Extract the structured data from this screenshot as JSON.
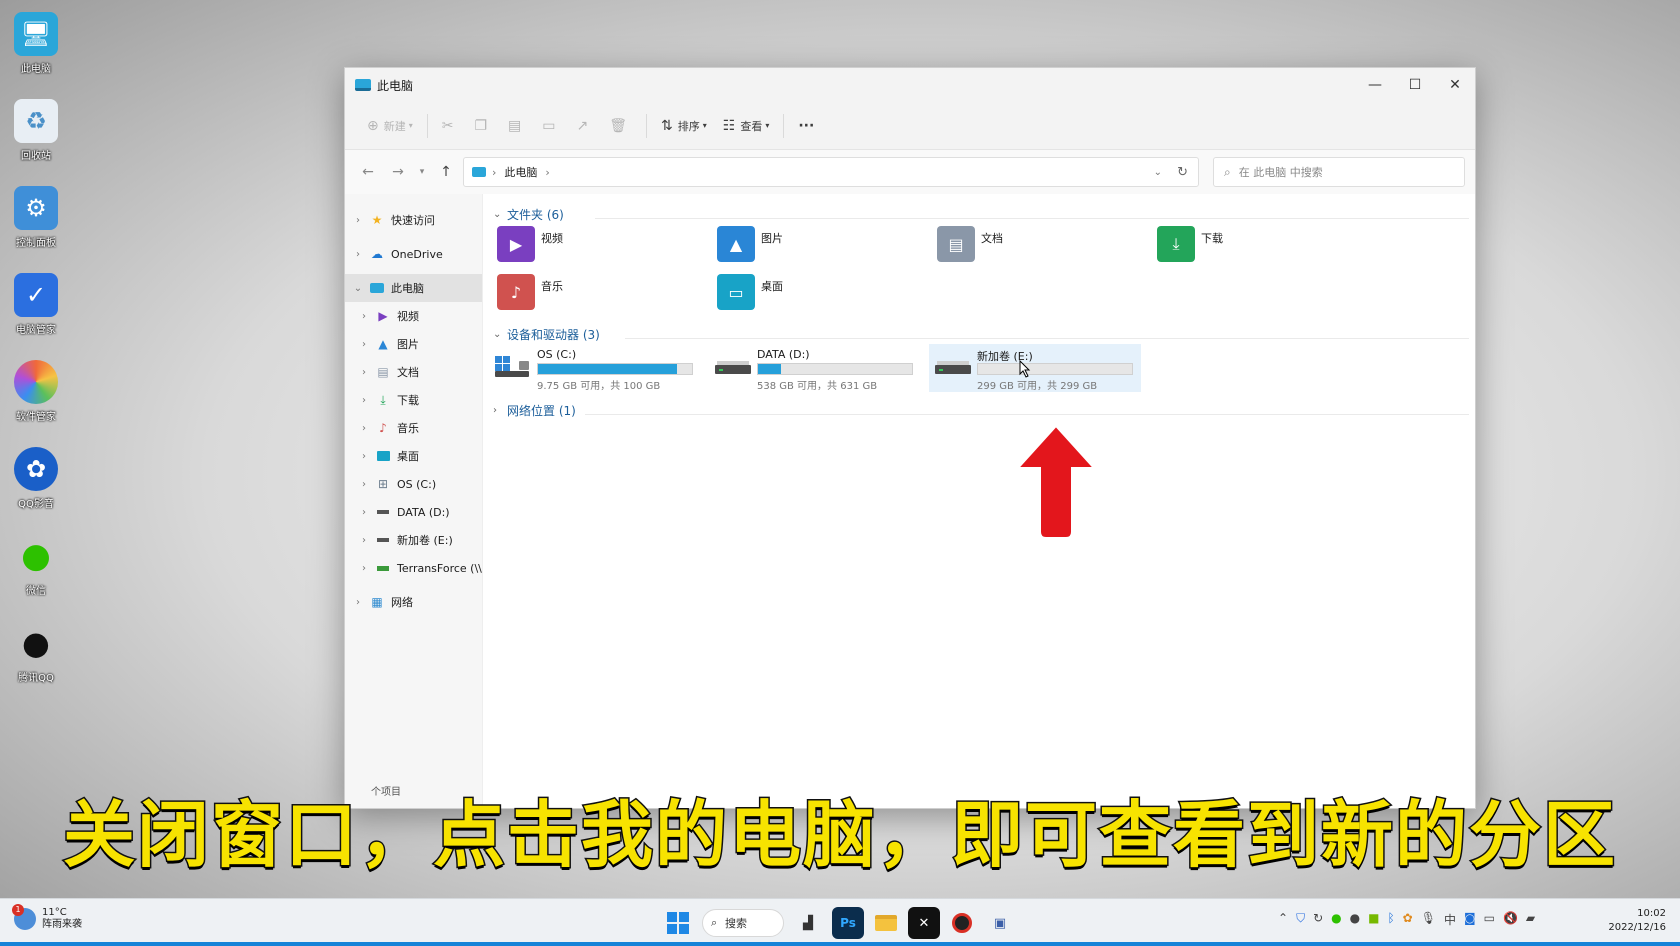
{
  "desktop": {
    "icons": [
      {
        "label": "此电脑",
        "icon": "computer-icon",
        "color": "#2aa6d9"
      },
      {
        "label": "回收站",
        "icon": "recycle-bin-icon",
        "color": "#4a90c8"
      },
      {
        "label": "控制面板",
        "icon": "control-panel-icon",
        "color": "#3f8fd8"
      },
      {
        "label": "电脑管家",
        "icon": "shield-icon",
        "color": "#2b6fe0"
      },
      {
        "label": "软件管家",
        "icon": "software-manager-icon",
        "color": "#f0683a"
      },
      {
        "label": "QQ影音",
        "icon": "player-icon",
        "color": "#1a5fc8"
      },
      {
        "label": "微信",
        "icon": "wechat-icon",
        "color": "#2dc100"
      },
      {
        "label": "腾讯QQ",
        "icon": "qq-icon",
        "color": "#111111"
      }
    ]
  },
  "window": {
    "title": "此电脑",
    "controls": {
      "minimize": "—",
      "maximize": "☐",
      "close": "✕"
    }
  },
  "toolbar": {
    "new_label": "新建",
    "sort_label": "排序",
    "view_label": "查看",
    "more_label": "···"
  },
  "address": {
    "crumb": "此电脑",
    "search_placeholder": "在 此电脑 中搜索"
  },
  "sidebar": {
    "items": [
      {
        "label": "快速访问",
        "icon": "star-icon",
        "color": "#f3b321"
      },
      {
        "label": "OneDrive",
        "icon": "cloud-icon",
        "color": "#1f78d1"
      },
      {
        "label": "此电脑",
        "icon": "computer-icon",
        "color": "#2aa6d9"
      },
      {
        "label": "视频",
        "icon": "video-folder-icon",
        "color": "#7a3fc0"
      },
      {
        "label": "图片",
        "icon": "pictures-folder-icon",
        "color": "#2a86d6"
      },
      {
        "label": "文档",
        "icon": "documents-folder-icon",
        "color": "#8a97a8"
      },
      {
        "label": "下载",
        "icon": "download-arrow-icon",
        "color": "#23a55a"
      },
      {
        "label": "音乐",
        "icon": "music-folder-icon",
        "color": "#d0524f"
      },
      {
        "label": "桌面",
        "icon": "desktop-folder-icon",
        "color": "#18a3c7"
      },
      {
        "label": "OS (C:)",
        "icon": "windows-drive-icon",
        "color": "#6f7f8f"
      },
      {
        "label": "DATA (D:)",
        "icon": "drive-icon",
        "color": "#555555"
      },
      {
        "label": "新加卷 (E:)",
        "icon": "drive-icon",
        "color": "#555555"
      },
      {
        "label": "TerransForce (\\\\",
        "icon": "network-drive-icon",
        "color": "#3b9a3b"
      },
      {
        "label": "网络",
        "icon": "network-icon",
        "color": "#2f8bd0"
      }
    ],
    "status": "个项目"
  },
  "folders_section": {
    "header": "文件夹 (6)",
    "items": [
      {
        "label": "视频",
        "icon": "video-folder-icon",
        "color": "#7a3fc0"
      },
      {
        "label": "图片",
        "icon": "pictures-folder-icon",
        "color": "#2a86d6"
      },
      {
        "label": "文档",
        "icon": "documents-folder-icon",
        "color": "#8a97a8"
      },
      {
        "label": "下载",
        "icon": "download-folder-icon",
        "color": "#23a55a"
      },
      {
        "label": "音乐",
        "icon": "music-folder-icon",
        "color": "#d0524f"
      },
      {
        "label": "桌面",
        "icon": "desktop-folder-icon",
        "color": "#18a3c7"
      }
    ]
  },
  "drives_section": {
    "header": "设备和驱动器 (3)",
    "drives": [
      {
        "name": "OS (C:)",
        "info": "9.75 GB 可用，共 100 GB",
        "used_fraction": 0.9025,
        "bar_color": "#26a0da",
        "icon": "windows-drive-icon"
      },
      {
        "name": "DATA (D:)",
        "info": "538 GB 可用，共 631 GB",
        "used_fraction": 0.147,
        "bar_color": "#26a0da",
        "icon": "drive-icon"
      },
      {
        "name": "新加卷 (E:)",
        "info": "299 GB 可用，共 299 GB",
        "used_fraction": 0.0,
        "bar_color": "#26a0da",
        "icon": "drive-icon"
      }
    ]
  },
  "network_section": {
    "header": "网络位置 (1)"
  },
  "subtitle": "关闭窗口，点击我的电脑，即可查看到新的分区",
  "taskbar": {
    "weather_temp": "11°C",
    "weather_desc": "阵雨来袭",
    "weather_badge": "1",
    "search_label": "搜索",
    "time": "10:02",
    "date": "2022/12/16"
  }
}
